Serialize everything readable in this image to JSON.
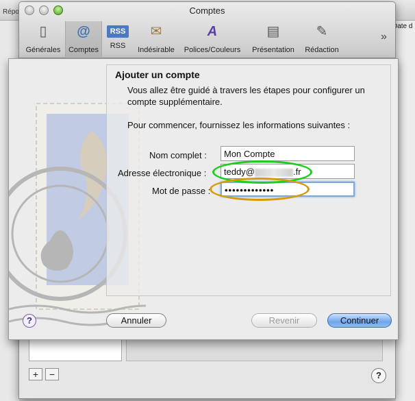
{
  "background": {
    "left_label": "Répo",
    "right_label": "Date d"
  },
  "window": {
    "title": "Comptes",
    "toolbar": {
      "items": [
        {
          "label": "Générales",
          "icon": "switch-icon"
        },
        {
          "label": "Comptes",
          "icon": "at-sign-icon",
          "selected": true
        },
        {
          "label": "RSS",
          "icon": "rss-icon"
        },
        {
          "label": "Indésirable",
          "icon": "junk-mail-icon"
        },
        {
          "label": "Polices/Couleurs",
          "icon": "fonts-colors-icon"
        },
        {
          "label": "Présentation",
          "icon": "presentation-icon"
        },
        {
          "label": "Rédaction",
          "icon": "compose-icon"
        }
      ],
      "overflow_glyph": "»"
    },
    "bottom": {
      "plus_label": "+",
      "minus_label": "−",
      "help_label": "?"
    }
  },
  "sheet": {
    "title": "Ajouter un compte",
    "intro": "Vous allez être guidé à travers les étapes pour configurer un compte supplémentaire.",
    "prompt": "Pour commencer, fournissez les informations suivantes :",
    "fields": {
      "name_label": "Nom complet :",
      "name_value": "Mon Compte",
      "email_label": "Adresse électronique :",
      "email_prefix": "teddy@",
      "email_suffix": ".fr",
      "password_label": "Mot de passe :",
      "password_value": "•••••••••••••"
    },
    "annotations": {
      "email_ring_color": "#19d11b",
      "password_ring_color": "#d79a0a"
    },
    "buttons": {
      "help": "?",
      "cancel": "Annuler",
      "back": "Revenir",
      "continue": "Continuer"
    }
  }
}
